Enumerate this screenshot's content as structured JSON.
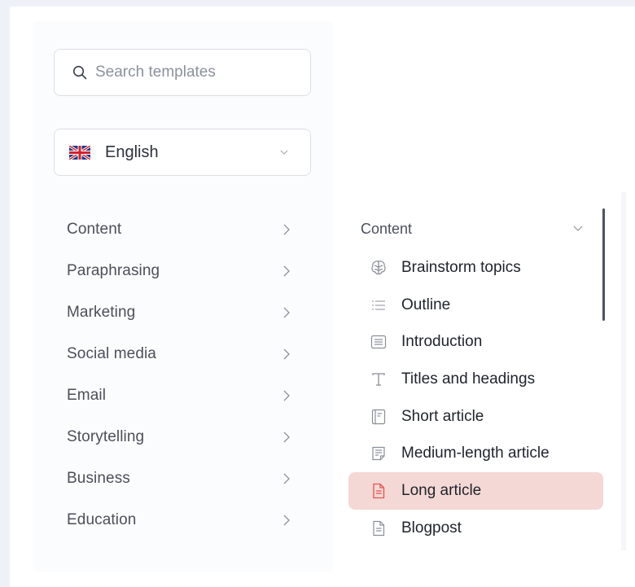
{
  "search": {
    "placeholder": "Search templates",
    "icon": "search-icon"
  },
  "language": {
    "label": "English",
    "flag": "uk-flag-icon"
  },
  "categories": [
    {
      "label": "Content"
    },
    {
      "label": "Paraphrasing"
    },
    {
      "label": "Marketing"
    },
    {
      "label": "Social media"
    },
    {
      "label": "Email"
    },
    {
      "label": "Storytelling"
    },
    {
      "label": "Business"
    },
    {
      "label": "Education"
    }
  ],
  "submenu": {
    "title": "Content",
    "items": [
      {
        "label": "Brainstorm topics",
        "icon": "brain-icon"
      },
      {
        "label": "Outline",
        "icon": "list-icon"
      },
      {
        "label": "Introduction",
        "icon": "paragraph-box-icon"
      },
      {
        "label": "Titles and headings",
        "icon": "text-t-icon"
      },
      {
        "label": "Short article",
        "icon": "short-article-icon"
      },
      {
        "label": "Medium-length article",
        "icon": "medium-article-icon"
      },
      {
        "label": "Long article",
        "icon": "long-article-icon",
        "selected": true
      },
      {
        "label": "Blogpost",
        "icon": "blogpost-icon"
      }
    ]
  },
  "colors": {
    "selected_bg": "#f4d8d6",
    "selected_icon": "#e5534b",
    "text": "#1f232b"
  }
}
